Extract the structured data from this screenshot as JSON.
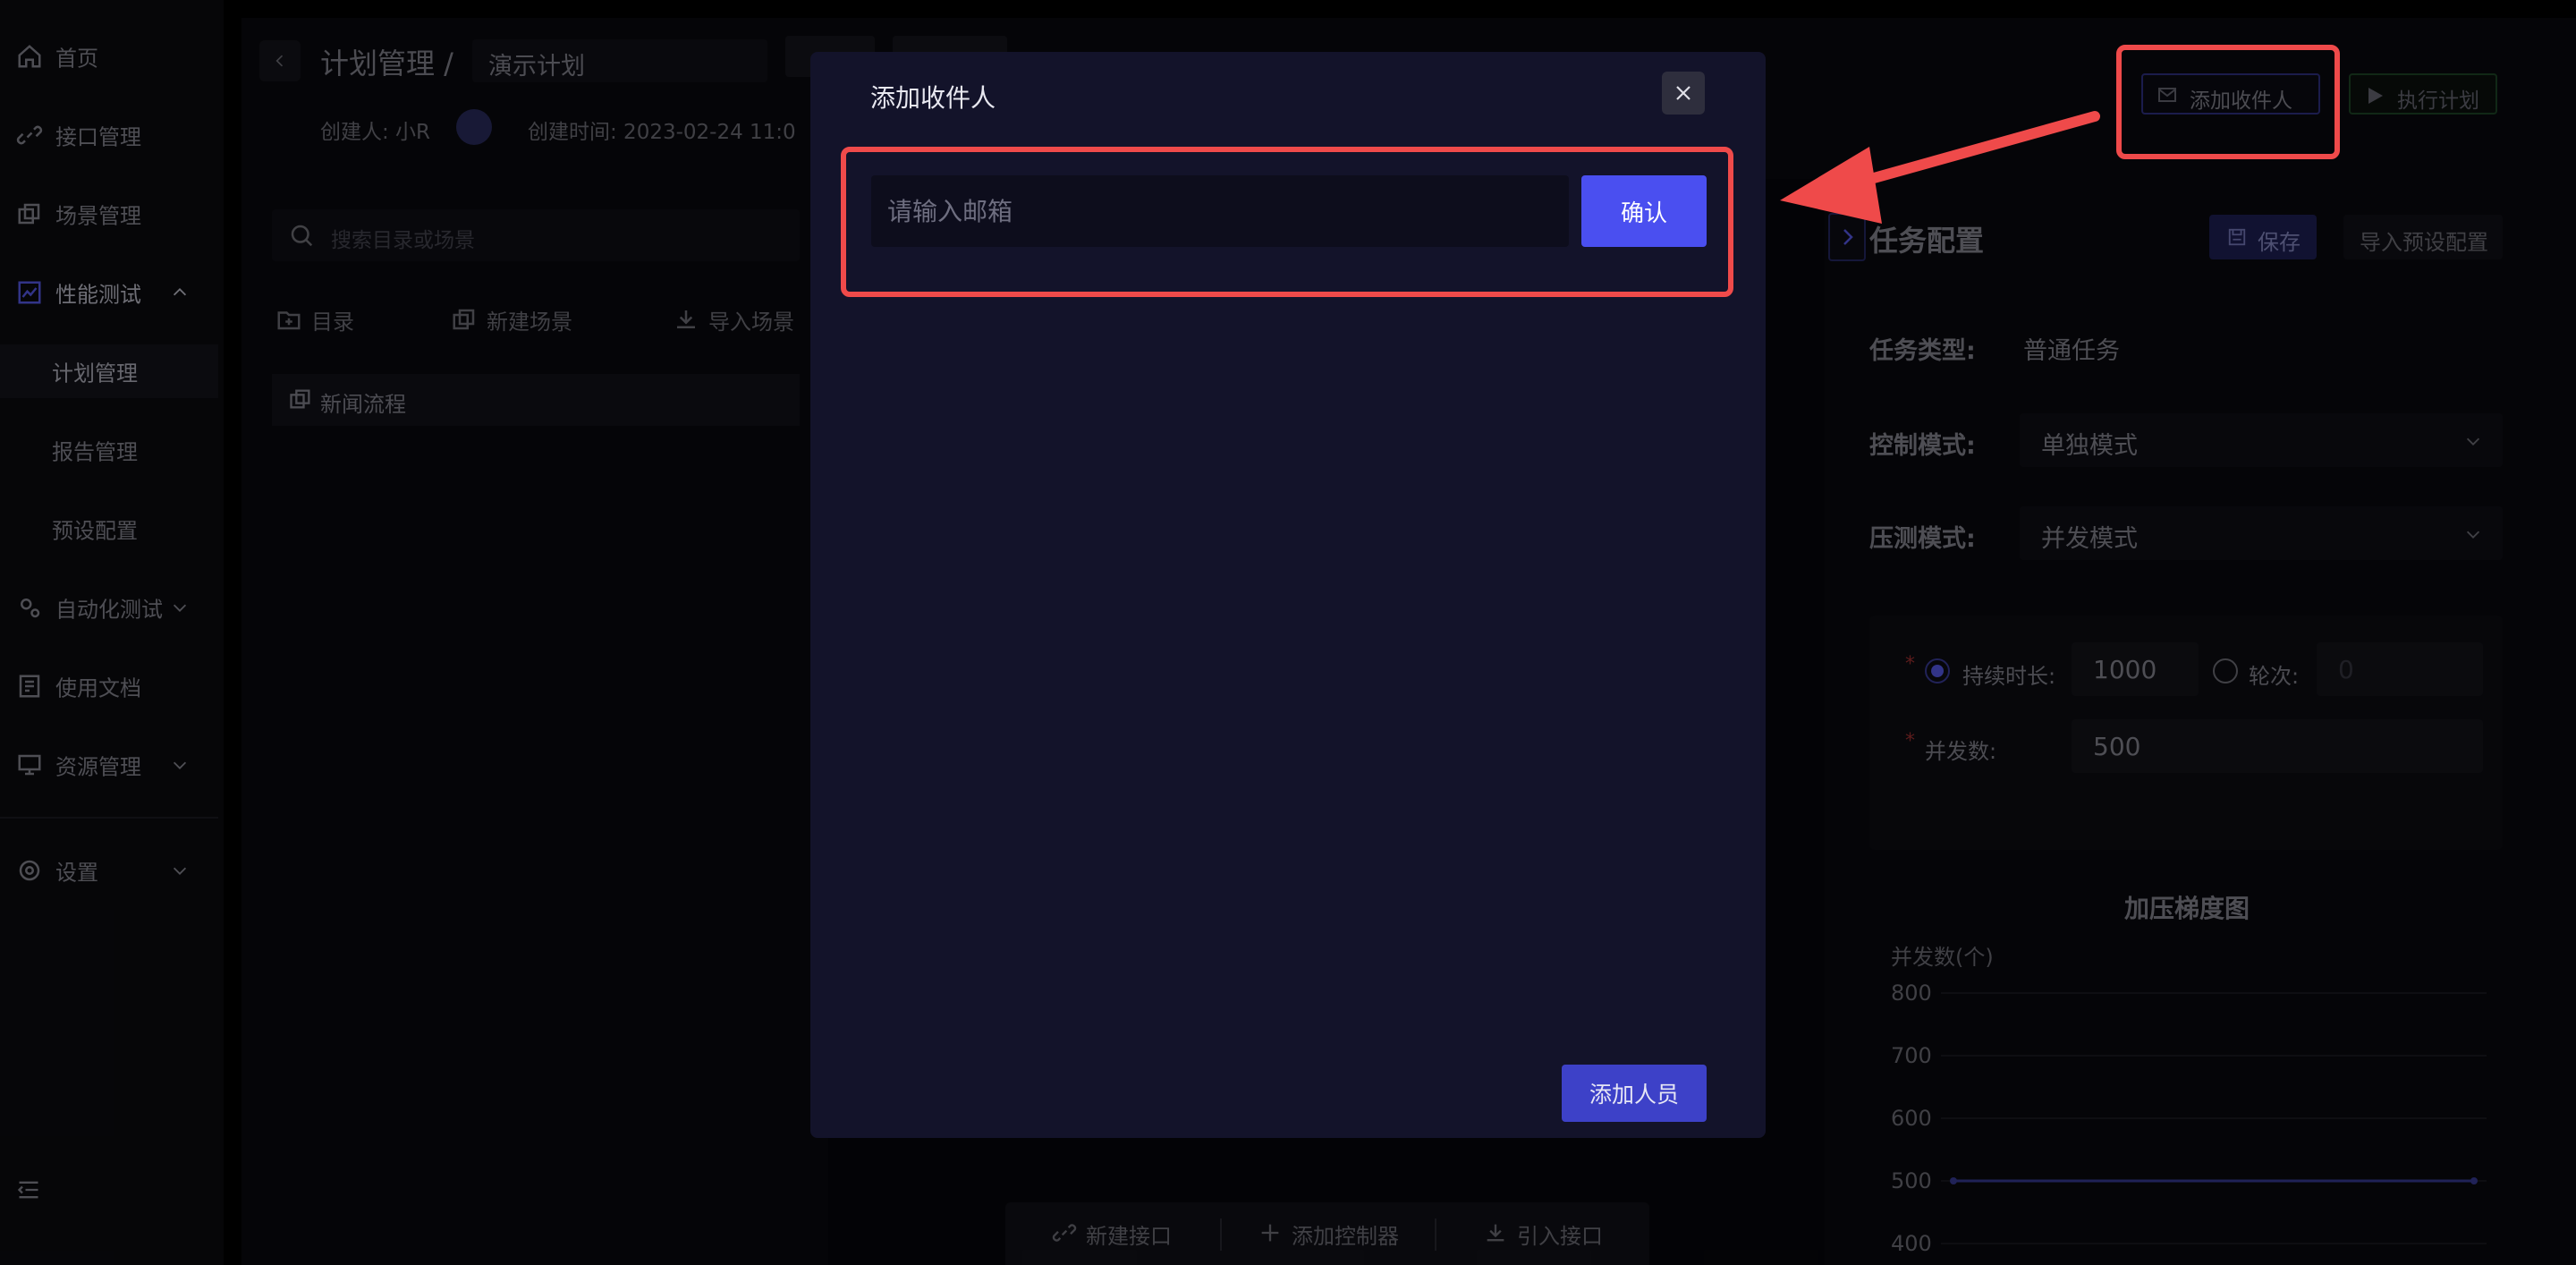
{
  "sidebar": {
    "items": [
      {
        "label": "首页"
      },
      {
        "label": "接口管理"
      },
      {
        "label": "场景管理"
      },
      {
        "label": "性能测试"
      },
      {
        "label": "自动化测试"
      },
      {
        "label": "使用文档"
      },
      {
        "label": "资源管理"
      },
      {
        "label": "设置"
      }
    ],
    "sub_items": [
      {
        "label": "计划管理"
      },
      {
        "label": "报告管理"
      },
      {
        "label": "预设配置"
      }
    ]
  },
  "header": {
    "breadcrumb": "计划管理 /",
    "plan_name": "演示计划",
    "creator_label": "创建人: 小R",
    "created_time": "创建时间: 2023-02-24 11:0",
    "add_recipient_label": "添加收件人",
    "execute_label": "执行计划"
  },
  "left_panel": {
    "search_placeholder": "搜索目录或场景",
    "tools": [
      "目录",
      "新建场景",
      "导入场景"
    ],
    "tree_item": "新闻流程"
  },
  "canvas_bar": {
    "buttons": [
      "新建接口",
      "添加控制器",
      "引入接口"
    ]
  },
  "task_config": {
    "title": "任务配置",
    "save_label": "保存",
    "import_preset_label": "导入预设配置",
    "task_type_label": "任务类型:",
    "task_type_value": "普通任务",
    "control_mode_label": "控制模式:",
    "control_mode_value": "单独模式",
    "stress_mode_label": "压测模式:",
    "stress_mode_value": "并发模式",
    "duration_label": "持续时长:",
    "duration_value": "1000",
    "rounds_label": "轮次:",
    "rounds_placeholder": "0",
    "concurrency_label": "并发数:",
    "concurrency_value": "500"
  },
  "chart_data": {
    "type": "line",
    "title": "加压梯度图",
    "ylabel": "并发数(个)",
    "y_ticks": [
      "800",
      "700",
      "600",
      "500",
      "400"
    ],
    "ylim": [
      400,
      800
    ],
    "series": [
      {
        "values": [
          500,
          500
        ]
      }
    ],
    "grid": true,
    "line_color": "#3b3f9e"
  },
  "modal": {
    "title": "添加收件人",
    "email_placeholder": "请输入邮箱",
    "confirm_label": "确认",
    "add_member_label": "添加人员"
  },
  "colors": {
    "accent": "#4a4ff0",
    "annotation": "#ef4a4a"
  }
}
